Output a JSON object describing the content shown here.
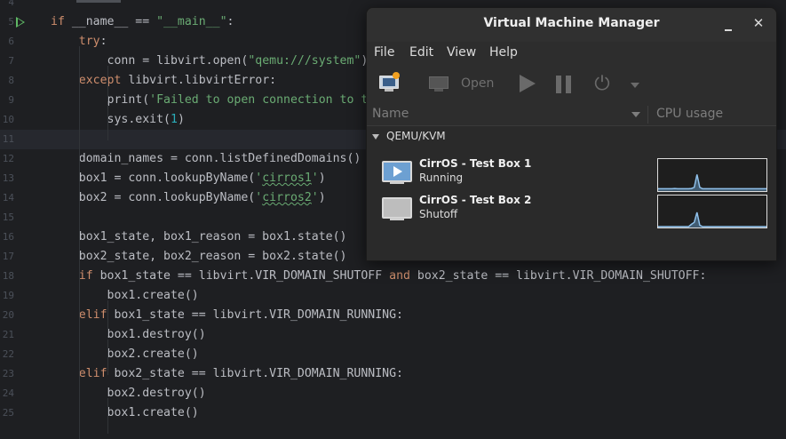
{
  "editor": {
    "lines": [
      {
        "num": "4",
        "top": 0,
        "html": ""
      },
      {
        "num": "5",
        "run": true,
        "html": "<span class='kw'>if</span> __name__ == <span class='str'>\"__main__\"</span>:"
      },
      {
        "num": "6",
        "html": "    <span class='kw'>try</span>:"
      },
      {
        "num": "7",
        "html": "        conn = libvirt.open(<span class='str'>\"qemu:///system\"</span>)"
      },
      {
        "num": "8",
        "html": "    <span class='kw'>except</span> libvirt.libvirtError:"
      },
      {
        "num": "9",
        "html": "        print(<span class='str'>'Failed to open connection to t</span>"
      },
      {
        "num": "10",
        "html": "        sys.exit(<span class='num'>1</span>)"
      },
      {
        "num": "11",
        "current": true,
        "html": ""
      },
      {
        "num": "12",
        "html": "    domain_names = conn.listDefinedDomains()"
      },
      {
        "num": "13",
        "html": "    box1 = conn.lookupByName(<span class='str'>'<span class=\"squiggle str\">cirros1</span>'</span>)"
      },
      {
        "num": "14",
        "html": "    box2 = conn.lookupByName(<span class='str'>'<span class=\"squiggle str\">cirros2</span>'</span>)"
      },
      {
        "num": "15",
        "html": ""
      },
      {
        "num": "16",
        "html": "    box1_state, box1_reason = box1.state()"
      },
      {
        "num": "17",
        "html": "    box2_state, box2_reason = box2.state()"
      },
      {
        "num": "18",
        "html": "    <span class='kw'>if</span> box1_state == libvirt.VIR_DOMAIN_SHUTOFF <span class='kw'>and</span> box2_state == libvirt.VIR_DOMAIN_SHUTOFF:"
      },
      {
        "num": "19",
        "html": "        box1.create()"
      },
      {
        "num": "20",
        "html": "    <span class='kw'>elif</span> box1_state == libvirt.VIR_DOMAIN_RUNNING:"
      },
      {
        "num": "21",
        "html": "        box1.destroy()"
      },
      {
        "num": "22",
        "html": "        box2.create()"
      },
      {
        "num": "23",
        "html": "    <span class='kw'>elif</span> box2_state == libvirt.VIR_DOMAIN_RUNNING:"
      },
      {
        "num": "24",
        "html": "        box2.destroy()"
      },
      {
        "num": "25",
        "html": "        box1.create()"
      }
    ]
  },
  "vmm": {
    "title": "Virtual Machine Manager",
    "close_glyph": "✕",
    "menu": [
      "File",
      "Edit",
      "View",
      "Help"
    ],
    "toolbar": {
      "open_label": "Open",
      "power_glyph": "⏻"
    },
    "columns": {
      "name": "Name",
      "cpu": "CPU usage"
    },
    "group": "QEMU/KVM",
    "vms": [
      {
        "name": "CirrOS - Test Box 1",
        "state": "Running",
        "running": true,
        "cpu_trace": [
          0.05,
          0.05,
          0.05,
          0.05,
          0.05,
          0.05,
          0.06,
          0.05,
          0.05,
          0.05,
          0.05,
          0.05,
          0.06,
          0.1,
          0.55,
          0.1,
          0.05,
          0.05,
          0.05,
          0.05,
          0.05,
          0.05,
          0.05,
          0.05,
          0.05,
          0.05,
          0.05,
          0.05,
          0.05,
          0.05,
          0.05,
          0.05,
          0.05,
          0.05,
          0.05,
          0.05,
          0.05,
          0.05,
          0.05,
          0.05
        ]
      },
      {
        "name": "CirrOS - Test Box 2",
        "state": "Shutoff",
        "running": false,
        "cpu_trace": [
          0.0,
          0.0,
          0.0,
          0.0,
          0.0,
          0.0,
          0.0,
          0.0,
          0.0,
          0.0,
          0.0,
          0.0,
          0.08,
          0.15,
          0.5,
          0.05,
          0.0,
          0.0,
          0.0,
          0.0,
          0.0,
          0.0,
          0.0,
          0.0,
          0.0,
          0.0,
          0.0,
          0.0,
          0.0,
          0.0,
          0.0,
          0.0,
          0.0,
          0.0,
          0.0,
          0.0,
          0.0,
          0.0,
          0.0,
          0.0
        ]
      }
    ]
  }
}
